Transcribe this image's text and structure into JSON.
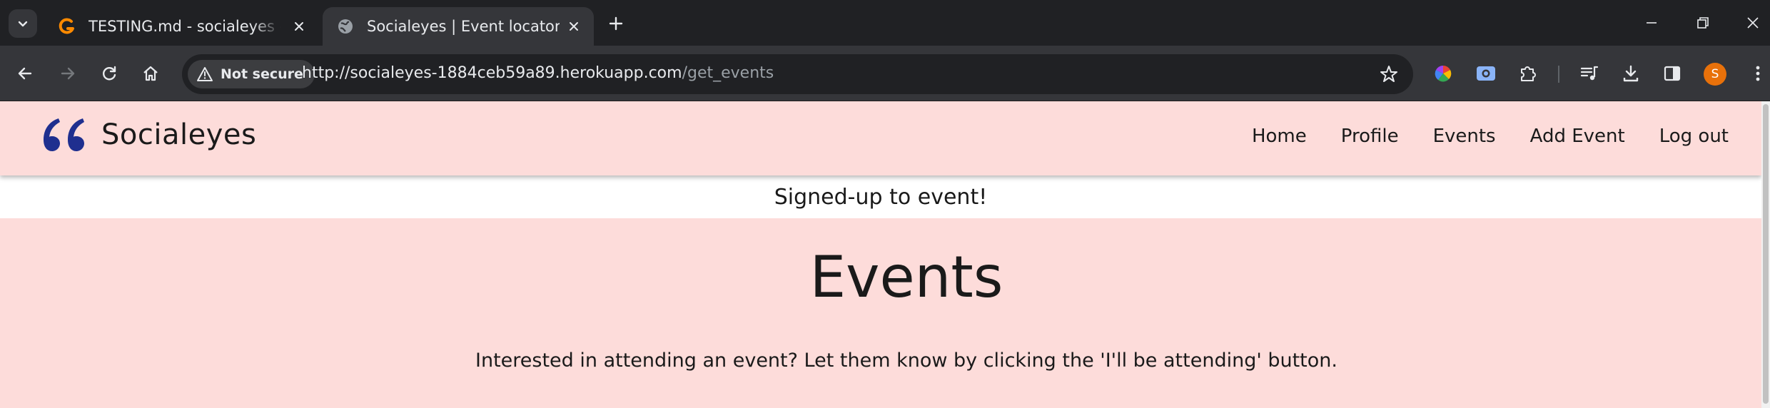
{
  "browser": {
    "tabs": [
      {
        "title": "TESTING.md - socialeyes - Gitpod",
        "active": false,
        "favicon": "gitpod-icon"
      },
      {
        "title": "Socialeyes | Event locator",
        "active": true,
        "favicon": "globe-icon"
      }
    ],
    "security_label": "Not secure",
    "url_host": "http://socialeyes-1884ceb59a89.herokuapp.com",
    "url_path": "/get_events",
    "profile_initial": "S",
    "colors": {
      "frame": "#202124",
      "toolbar": "#35363a",
      "avatar": "#e8710a"
    }
  },
  "site": {
    "brand": "Socialeyes",
    "nav": [
      "Home",
      "Profile",
      "Events",
      "Add Event",
      "Log out"
    ],
    "flash_message": "Signed-up to event!",
    "heading": "Events",
    "subheading": "Interested in attending an event? Let them know by clicking the 'I'll be attending' button.",
    "colors": {
      "background": "#fddcda",
      "logo": "#1f2f8f",
      "text": "#1a1a1a"
    }
  }
}
